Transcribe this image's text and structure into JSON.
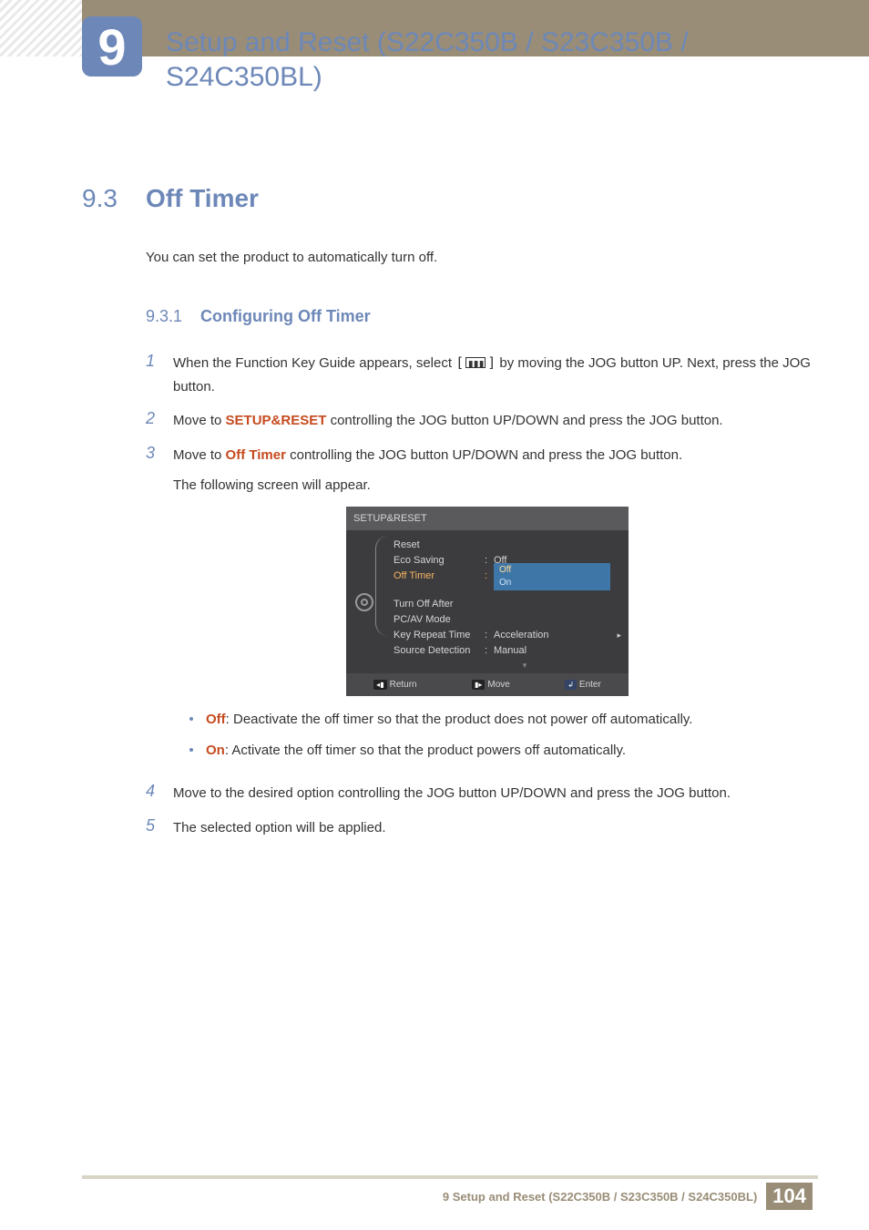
{
  "chapter": {
    "num": "9",
    "title": "Setup and Reset (S22C350B / S23C350B / S24C350BL)"
  },
  "section": {
    "num": "9.3",
    "title": "Off Timer"
  },
  "intro": "You can set the product to automatically turn off.",
  "subsection": {
    "num": "9.3.1",
    "title": "Configuring Off Timer"
  },
  "steps": [
    {
      "num": "1",
      "pre": "When the Function Key Guide appears, select ",
      "post": " by moving the JOG button UP. Next, press the JOG button."
    },
    {
      "num": "2",
      "pre": "Move to ",
      "hl": "SETUP&RESET",
      "post": " controlling the JOG button UP/DOWN and press the JOG button."
    },
    {
      "num": "3",
      "pre": "Move to ",
      "hl": "Off Timer",
      "post": " controlling the JOG button UP/DOWN and press the JOG button.",
      "tail": "The following screen will appear."
    },
    {
      "num": "4",
      "text": "Move to the desired option controlling the JOG button UP/DOWN and press the JOG button."
    },
    {
      "num": "5",
      "text": "The selected option will be applied."
    }
  ],
  "osd": {
    "title": "SETUP&RESET",
    "items": [
      {
        "label": "Reset",
        "val": ""
      },
      {
        "label": "Eco Saving",
        "val": "Off"
      },
      {
        "label": "Off Timer",
        "val": "",
        "active": true,
        "dropdown": [
          "Off",
          "On"
        ]
      },
      {
        "label": "Turn Off After",
        "val": ""
      },
      {
        "label": "PC/AV Mode",
        "val": ""
      },
      {
        "label": "Key Repeat Time",
        "val": "Acceleration"
      },
      {
        "label": "Source Detection",
        "val": "Manual"
      }
    ],
    "footer": {
      "return": "Return",
      "move": "Move",
      "enter": "Enter"
    }
  },
  "bullets": [
    {
      "hl": "Off",
      "text": ": Deactivate the off timer so that the product does not power off automatically."
    },
    {
      "hl": "On",
      "text": ": Activate the off timer so that the product powers off automatically."
    }
  ],
  "footer": {
    "text": "9 Setup and Reset (S22C350B / S23C350B / S24C350BL)",
    "page": "104"
  }
}
